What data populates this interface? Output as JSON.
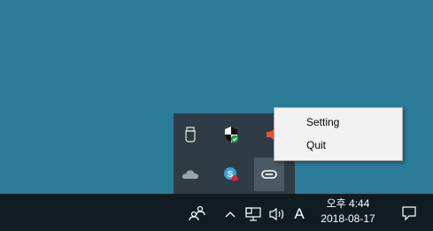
{
  "context_menu": {
    "items": [
      {
        "label": "Setting"
      },
      {
        "label": "Quit"
      }
    ]
  },
  "tray_overflow": {
    "icons": [
      "usb-device-icon",
      "windows-defender-shield-icon",
      "speaker-muted-icon",
      "onedrive-cloud-icon",
      "skype-icon",
      "link-chain-icon"
    ]
  },
  "taskbar": {
    "people_icon": "people-icon",
    "chevron_icon": "chevron-up-icon",
    "network_icon": "network-icon",
    "volume_icon": "volume-icon",
    "ime_indicator": "A",
    "clock": {
      "time": "오후 4:44",
      "date": "2018-08-17"
    },
    "notification_icon": "action-center-icon"
  },
  "colors": {
    "desktop": "#2b7c98",
    "taskbar": "#101c22",
    "flyout": "#2f3c45",
    "menu_bg": "#f2f2f2"
  }
}
